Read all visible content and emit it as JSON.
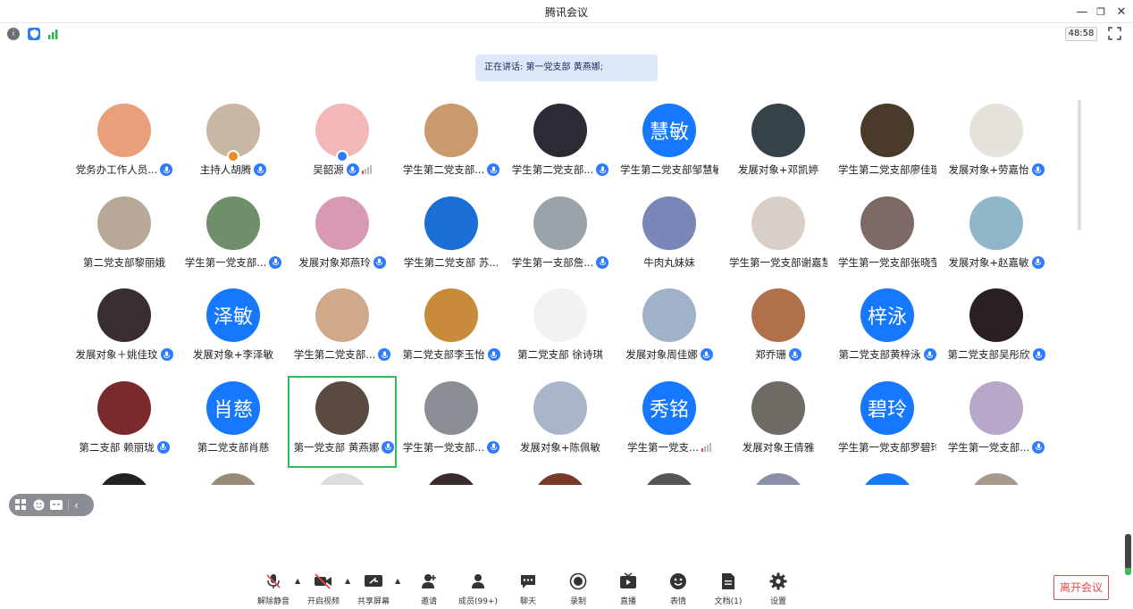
{
  "window": {
    "title": "腾讯会议",
    "minimize": "—",
    "restore": "❐",
    "close": "✕"
  },
  "status": {
    "timer": "48:58",
    "icons": [
      "info-icon",
      "shield-icon",
      "signal-icon",
      "fullscreen-icon"
    ]
  },
  "speaking_banner": "正在讲话: 第一党支部 黄燕娜;",
  "participants": [
    {
      "name": "党务办工作人员...",
      "avatar_text": "",
      "color": "#e8a07a",
      "mic": true
    },
    {
      "name": "主持人胡腾",
      "avatar_text": "",
      "color": "#c9b7a4",
      "mic": true,
      "host": true
    },
    {
      "name": "吴韶源",
      "avatar_text": "",
      "color": "#f4b7b7",
      "mic": true,
      "signal": true,
      "host": true
    },
    {
      "name": "学生第二党支部...",
      "avatar_text": "",
      "color": "#c89a6c",
      "mic": true
    },
    {
      "name": "学生第二党支部...",
      "avatar_text": "",
      "color": "#2b2b33",
      "mic": true
    },
    {
      "name": "学生第二党支部邹慧敏",
      "avatar_text": "慧敏",
      "color": "#1677ff",
      "mic": false
    },
    {
      "name": "发展对象+邓凯婷",
      "avatar_text": "",
      "color": "#34424a",
      "mic": false
    },
    {
      "name": "学生第二党支部廖佳璇",
      "avatar_text": "",
      "color": "#4a3a2a",
      "mic": false
    },
    {
      "name": "发展对象+劳嘉怡",
      "avatar_text": "",
      "color": "#e5e2dc",
      "mic": true
    },
    {
      "name": "第二党支部黎丽娥",
      "avatar_text": "",
      "color": "#b8a898",
      "mic": false
    },
    {
      "name": "学生第一党支部...",
      "avatar_text": "",
      "color": "#6f8f6a",
      "mic": true
    },
    {
      "name": "发展对象郑燕玲",
      "avatar_text": "",
      "color": "#d79ab2",
      "mic": true
    },
    {
      "name": "学生第二党支部 苏...",
      "avatar_text": "",
      "color": "#1a6fd6",
      "mic": false
    },
    {
      "name": "学生第一支部詹...",
      "avatar_text": "",
      "color": "#9aa3a8",
      "mic": true
    },
    {
      "name": "牛肉丸妹妹",
      "avatar_text": "",
      "color": "#7a86b8",
      "mic": false
    },
    {
      "name": "学生第一党支部谢嘉慧",
      "avatar_text": "",
      "color": "#d9cfc7",
      "mic": false
    },
    {
      "name": "学生第一党支部张晓莹",
      "avatar_text": "",
      "color": "#7d6a66",
      "mic": false
    },
    {
      "name": "发展对象+赵嘉敏",
      "avatar_text": "",
      "color": "#8fb6c9",
      "mic": true
    },
    {
      "name": "发展对象＋姚佳玟",
      "avatar_text": "",
      "color": "#3a2e33",
      "mic": true
    },
    {
      "name": "发展对象+李泽敏",
      "avatar_text": "泽敏",
      "color": "#1677ff",
      "mic": false
    },
    {
      "name": "学生第二党支部...",
      "avatar_text": "",
      "color": "#cfa98a",
      "mic": true
    },
    {
      "name": "第二党支部李玉怡",
      "avatar_text": "",
      "color": "#c88b3a",
      "mic": true
    },
    {
      "name": "第二党支部 徐诗琪",
      "avatar_text": "",
      "color": "#f2f2f2",
      "mic": false
    },
    {
      "name": "发展对象周佳娜",
      "avatar_text": "",
      "color": "#9fb2c8",
      "mic": true
    },
    {
      "name": "郑乔珊",
      "avatar_text": "",
      "color": "#b0704a",
      "mic": true
    },
    {
      "name": "第二党支部黄梓泳",
      "avatar_text": "梓泳",
      "color": "#1677ff",
      "mic": true
    },
    {
      "name": "第二党支部吴彤欣",
      "avatar_text": "",
      "color": "#2a1f22",
      "mic": true
    },
    {
      "name": "第二支部 赖丽珑",
      "avatar_text": "",
      "color": "#7a2a2a",
      "mic": true
    },
    {
      "name": "第二党支部肖慈",
      "avatar_text": "肖慈",
      "color": "#1677ff",
      "mic": false
    },
    {
      "name": "第一党支部 黄燕娜",
      "avatar_text": "",
      "color": "#5a4a40",
      "mic": true,
      "active": true
    },
    {
      "name": "学生第一党支部...",
      "avatar_text": "",
      "color": "#8a8f96",
      "mic": true
    },
    {
      "name": "发展对象+陈佩敏",
      "avatar_text": "",
      "color": "#a9b6c9",
      "mic": false
    },
    {
      "name": "学生第一党支...",
      "avatar_text": "秀铭",
      "color": "#1677ff",
      "mic": false,
      "signal": true
    },
    {
      "name": "发展对象王倩雅",
      "avatar_text": "",
      "color": "#6e6a64",
      "mic": false
    },
    {
      "name": "学生第一党支部罗碧玲",
      "avatar_text": "碧玲",
      "color": "#1677ff",
      "mic": false
    },
    {
      "name": "学生第一党支部...",
      "avatar_text": "",
      "color": "#b9a7c9",
      "mic": true
    },
    {
      "name": "",
      "avatar_text": "",
      "color": "#222",
      "mic": false
    },
    {
      "name": "",
      "avatar_text": "",
      "color": "#9a8a7a",
      "mic": false
    },
    {
      "name": "",
      "avatar_text": "",
      "color": "#ddd",
      "mic": false
    },
    {
      "name": "",
      "avatar_text": "",
      "color": "#3a2c2a",
      "mic": false
    },
    {
      "name": "",
      "avatar_text": "",
      "color": "#7a3a2a",
      "mic": false
    },
    {
      "name": "",
      "avatar_text": "",
      "color": "#555",
      "mic": false
    },
    {
      "name": "",
      "avatar_text": "",
      "color": "#8a90a8",
      "mic": false
    },
    {
      "name": "",
      "avatar_text": "",
      "color": "#1677ff",
      "mic": false
    },
    {
      "name": "",
      "avatar_text": "",
      "color": "#a89a8a",
      "mic": false
    }
  ],
  "toolbar": {
    "unmute": "解除静音",
    "start_video": "开启视频",
    "share_screen": "共享屏幕",
    "invite": "邀请",
    "members": "成员(99+)",
    "chat": "聊天",
    "record": "录制",
    "live": "直播",
    "reactions": "表情",
    "docs": "文档(1)",
    "settings": "设置",
    "leave": "离开会议"
  },
  "colors": {
    "accent": "#1677ff",
    "active_border": "#2fbf5a",
    "leave": "#e34a4a",
    "banner": "#dde9fb"
  }
}
